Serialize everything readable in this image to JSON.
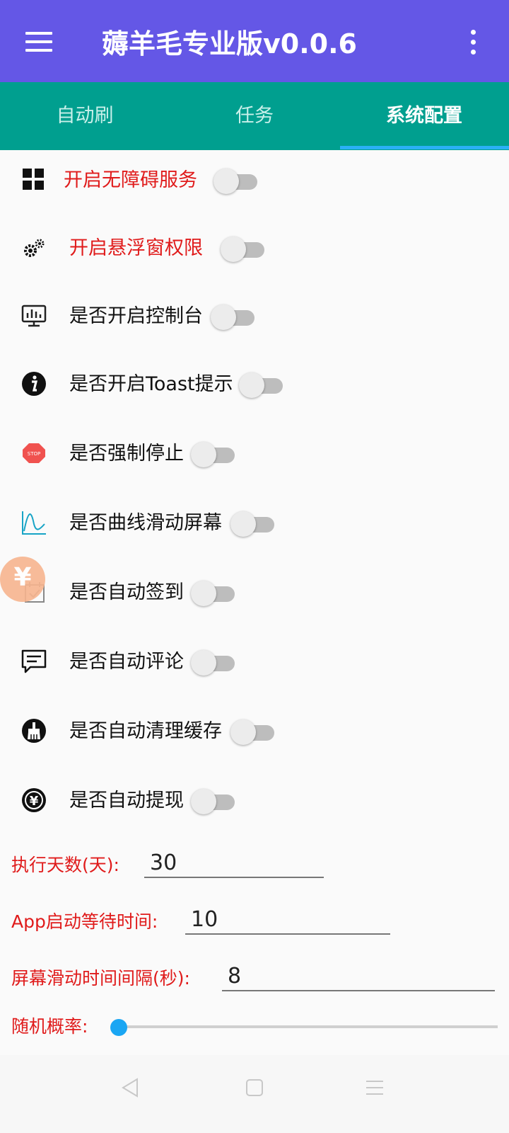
{
  "app": {
    "title": "薅羊毛专业版v0.0.6"
  },
  "tabs": [
    {
      "label": "自动刷"
    },
    {
      "label": "任务"
    },
    {
      "label": "系统配置"
    }
  ],
  "active_tab": "系统配置",
  "settings": [
    {
      "label": "开启无障碍服务",
      "icon": "grid-icon",
      "enabled": false,
      "highlight": true
    },
    {
      "label": "开启悬浮窗权限",
      "icon": "gears-icon",
      "enabled": false,
      "highlight": true
    },
    {
      "label": "是否开启控制台",
      "icon": "monitor-chart-icon",
      "enabled": false,
      "highlight": false
    },
    {
      "label": "是否开启Toast提示",
      "icon": "info-icon",
      "enabled": false,
      "highlight": false
    },
    {
      "label": "是否强制停止",
      "icon": "stop-sign-icon",
      "enabled": false,
      "highlight": false
    },
    {
      "label": "是否曲线滑动屏幕",
      "icon": "curve-icon",
      "enabled": false,
      "highlight": false
    },
    {
      "label": "是否自动签到",
      "icon": "calendar-check-icon",
      "enabled": false,
      "highlight": false
    },
    {
      "label": "是否自动评论",
      "icon": "comment-icon",
      "enabled": false,
      "highlight": false
    },
    {
      "label": "是否自动清理缓存",
      "icon": "broom-icon",
      "enabled": false,
      "highlight": false
    },
    {
      "label": "是否自动提现",
      "icon": "yuan-coin-icon",
      "enabled": false,
      "highlight": false
    }
  ],
  "fields": [
    {
      "label": "执行天数(天):",
      "value": "30"
    },
    {
      "label": "App启动等待时间:",
      "value": "10"
    },
    {
      "label": "屏幕滑动时间间隔(秒):",
      "value": "8"
    }
  ],
  "slider": {
    "label": "随机概率:",
    "value": 0
  },
  "floating_button": {
    "glyph": "¥"
  },
  "colors": {
    "appbar": "#6457e6",
    "tabbar": "#009f8f",
    "warning_text": "#e01b1b",
    "accent": "#1aa6f3"
  }
}
